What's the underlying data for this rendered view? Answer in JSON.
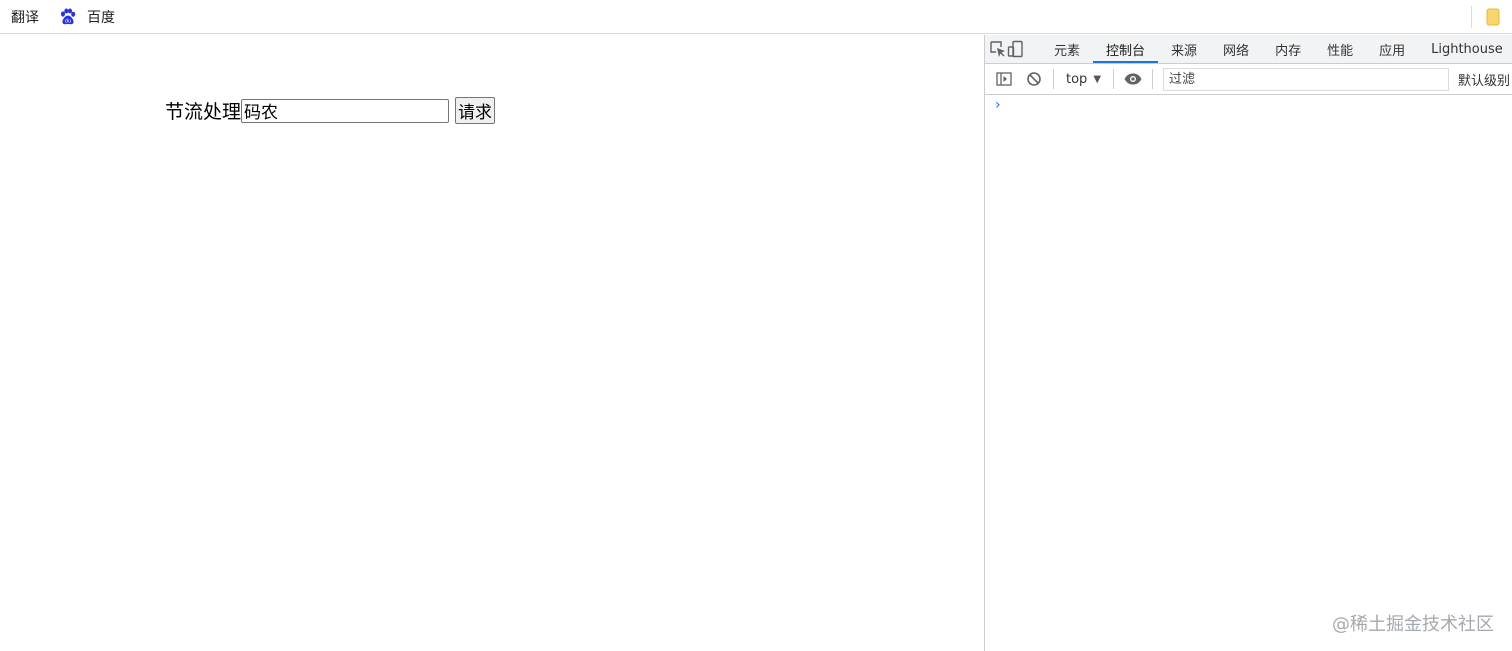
{
  "bookmarks": {
    "items": [
      {
        "label": "翻译",
        "icon": "none"
      },
      {
        "label": "百度",
        "icon": "baidu-paw-icon"
      }
    ],
    "folder_icon": "folder-icon"
  },
  "page": {
    "label": "节流处理",
    "input_value": "码农",
    "button_label": "请求"
  },
  "devtools": {
    "tools": [
      "inspect-element-icon",
      "device-toggle-icon"
    ],
    "tabs": [
      {
        "label": "元素",
        "active": false
      },
      {
        "label": "控制台",
        "active": true
      },
      {
        "label": "来源",
        "active": false
      },
      {
        "label": "网络",
        "active": false
      },
      {
        "label": "内存",
        "active": false
      },
      {
        "label": "性能",
        "active": false
      },
      {
        "label": "应用",
        "active": false
      },
      {
        "label": "Lighthouse",
        "active": false
      }
    ],
    "toolbar": {
      "context": "top",
      "filter_placeholder": "过滤",
      "levels_label": "默认级别"
    },
    "prompt": "›"
  },
  "watermark": "@稀土掘金技术社区",
  "colors": {
    "accent": "#1a73e8",
    "baidu_blue": "#2932e1",
    "folder_yellow": "#f9d56e"
  }
}
